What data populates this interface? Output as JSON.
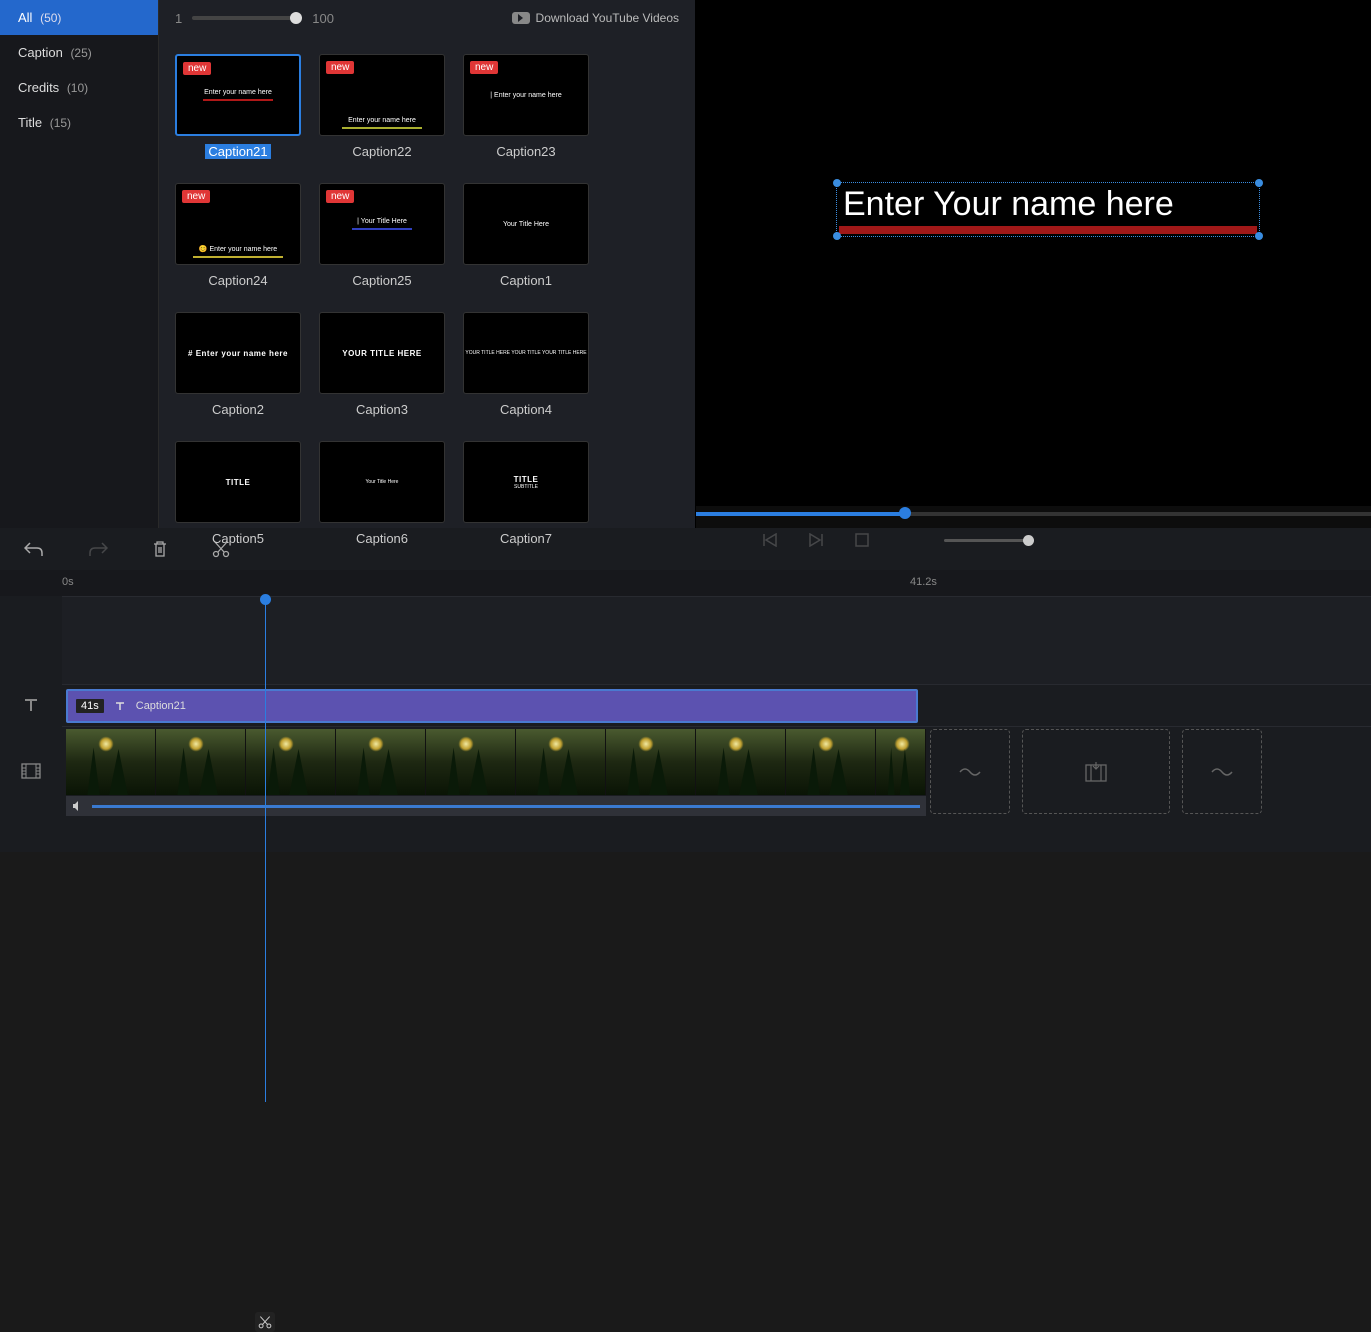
{
  "sidebar": {
    "items": [
      {
        "label": "All",
        "count": "(50)",
        "active": true
      },
      {
        "label": "Caption",
        "count": "(25)",
        "active": false
      },
      {
        "label": "Credits",
        "count": "(10)",
        "active": false
      },
      {
        "label": "Title",
        "count": "(15)",
        "active": false
      }
    ]
  },
  "browser": {
    "zoom_min": "1",
    "zoom_max": "100",
    "download_label": "Download YouTube Videos",
    "thumbs": [
      {
        "label": "Caption21",
        "badge": "new",
        "selected": true,
        "preview_text": "Enter your name here",
        "line_color": "#b01818",
        "line_w": 70
      },
      {
        "label": "Caption22",
        "badge": "new",
        "selected": false,
        "preview_text": "Enter your name here",
        "line_color": "#aab030",
        "line_w": 80,
        "align": "bottom"
      },
      {
        "label": "Caption23",
        "badge": "new",
        "selected": false,
        "preview_text": "| Enter your name here",
        "line_color": "",
        "line_w": 0
      },
      {
        "label": "Caption24",
        "badge": "new",
        "selected": false,
        "preview_text": "😊 Enter your name here",
        "line_color": "#c0b030",
        "line_w": 90,
        "align": "bottom"
      },
      {
        "label": "Caption25",
        "badge": "new",
        "selected": false,
        "preview_text": "| Your Title Here",
        "line_color": "#3040c0",
        "line_w": 60
      },
      {
        "label": "Caption1",
        "badge": "",
        "selected": false,
        "preview_text": "Your  Title Here",
        "line_color": "",
        "line_w": 0
      },
      {
        "label": "Caption2",
        "badge": "",
        "selected": false,
        "preview_text": "# Enter your name here",
        "line_color": "",
        "line_w": 0,
        "bold": true
      },
      {
        "label": "Caption3",
        "badge": "",
        "selected": false,
        "preview_text": "YOUR TITLE HERE",
        "line_color": "",
        "line_w": 0,
        "bold": true
      },
      {
        "label": "Caption4",
        "badge": "",
        "selected": false,
        "preview_text": "YOUR TITLE HERE YOUR TITLE YOUR TITLE HERE",
        "line_color": "",
        "line_w": 0,
        "tiny": true
      },
      {
        "label": "Caption5",
        "badge": "",
        "selected": false,
        "preview_text": "TITLE",
        "line_color": "",
        "line_w": 0,
        "bold": true
      },
      {
        "label": "Caption6",
        "badge": "",
        "selected": false,
        "preview_text": "Your  Title Here",
        "line_color": "",
        "line_w": 0,
        "tiny": true
      },
      {
        "label": "Caption7",
        "badge": "",
        "selected": false,
        "preview_text": "TITLE",
        "subtext": "SUBTITLE",
        "line_color": "",
        "line_w": 0,
        "bold": true
      }
    ]
  },
  "preview": {
    "overlay_text": "Enter Your name here",
    "volume_value": "100"
  },
  "timeline": {
    "ruler_start": "0s",
    "ruler_mark": "41.2s",
    "text_clip_duration": "41s",
    "text_clip_name": "Caption21",
    "playhead_pct": 23.5
  }
}
